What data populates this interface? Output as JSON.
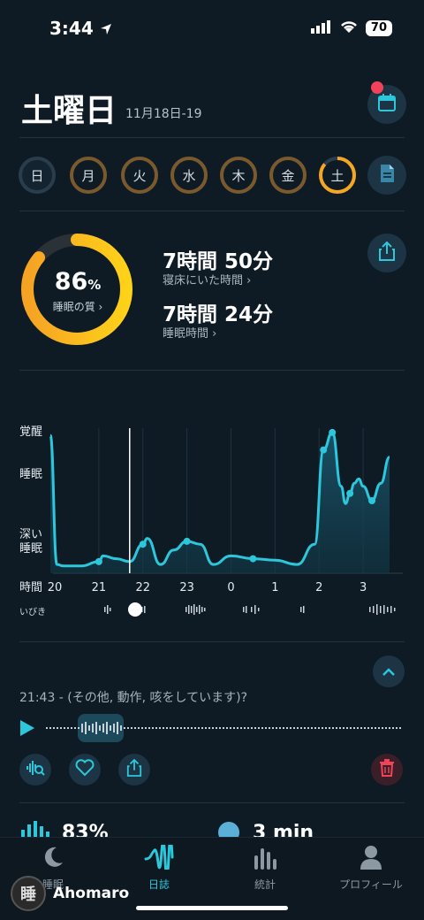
{
  "status_bar": {
    "time": "3:44",
    "battery": "70"
  },
  "header": {
    "day": "土曜日",
    "date_range": "11月18日-19"
  },
  "week": {
    "days": [
      {
        "label": "日",
        "score": 0
      },
      {
        "label": "月",
        "score": 0.85
      },
      {
        "label": "火",
        "score": 0.85
      },
      {
        "label": "水",
        "score": 0.85
      },
      {
        "label": "木",
        "score": 0.85
      },
      {
        "label": "金",
        "score": 0.85
      },
      {
        "label": "土",
        "score": 0.86
      }
    ],
    "selected": "土"
  },
  "summary": {
    "quality_value": "86",
    "quality_unit": "%",
    "quality_label": "睡眠の質 ›",
    "quality_score": 0.86,
    "time_in_bed": "7時間 50分",
    "time_in_bed_label": "寝床にいた時間 ›",
    "sleep_time": "7時間 24分",
    "sleep_time_label": "睡眠時間 ›"
  },
  "chart_data": {
    "type": "area",
    "ylabels": [
      "覚醒",
      "睡眠",
      "深い\n睡眠"
    ],
    "x_axis_title": "時間",
    "xticks": [
      "20",
      "21",
      "22",
      "23",
      "0",
      "1",
      "2",
      "3"
    ],
    "snore_label": "いびき",
    "x_hours": [
      19.9,
      20.05,
      20.2,
      20.6,
      21.0,
      21.1,
      21.4,
      21.7,
      22.0,
      22.1,
      22.4,
      22.7,
      23.0,
      23.3,
      23.6,
      24.0,
      24.5,
      25.0,
      25.5,
      25.9,
      26.1,
      26.3,
      26.5,
      26.6,
      26.7,
      26.8,
      26.9,
      27.0,
      27.2,
      27.4,
      27.6
    ],
    "y_level": [
      0.95,
      0.06,
      0.05,
      0.05,
      0.08,
      0.12,
      0.1,
      0.08,
      0.2,
      0.24,
      0.06,
      0.16,
      0.22,
      0.2,
      0.06,
      0.12,
      0.1,
      0.09,
      0.06,
      0.2,
      0.85,
      0.97,
      0.6,
      0.48,
      0.55,
      0.62,
      0.65,
      0.6,
      0.5,
      0.62,
      0.8
    ],
    "current_marker_hour": 21.7
  },
  "event": {
    "text": "21:43 - (その他, 動作, 咳をしています)?"
  },
  "summary_row": {
    "left_value": "83%",
    "right_value": "3 min"
  },
  "nav": {
    "items": [
      {
        "label": "睡眠",
        "icon": "moon-icon"
      },
      {
        "label": "日誌",
        "icon": "wave-icon"
      },
      {
        "label": "統計",
        "icon": "bars-icon"
      },
      {
        "label": "プロフィール",
        "icon": "person-icon"
      }
    ],
    "active": "日誌"
  },
  "brand": {
    "name": "Ahomaro",
    "logo_char": "睡"
  },
  "colors": {
    "accent": "#2dc7dc",
    "ring": "#f5a623",
    "danger": "#f1425a"
  }
}
